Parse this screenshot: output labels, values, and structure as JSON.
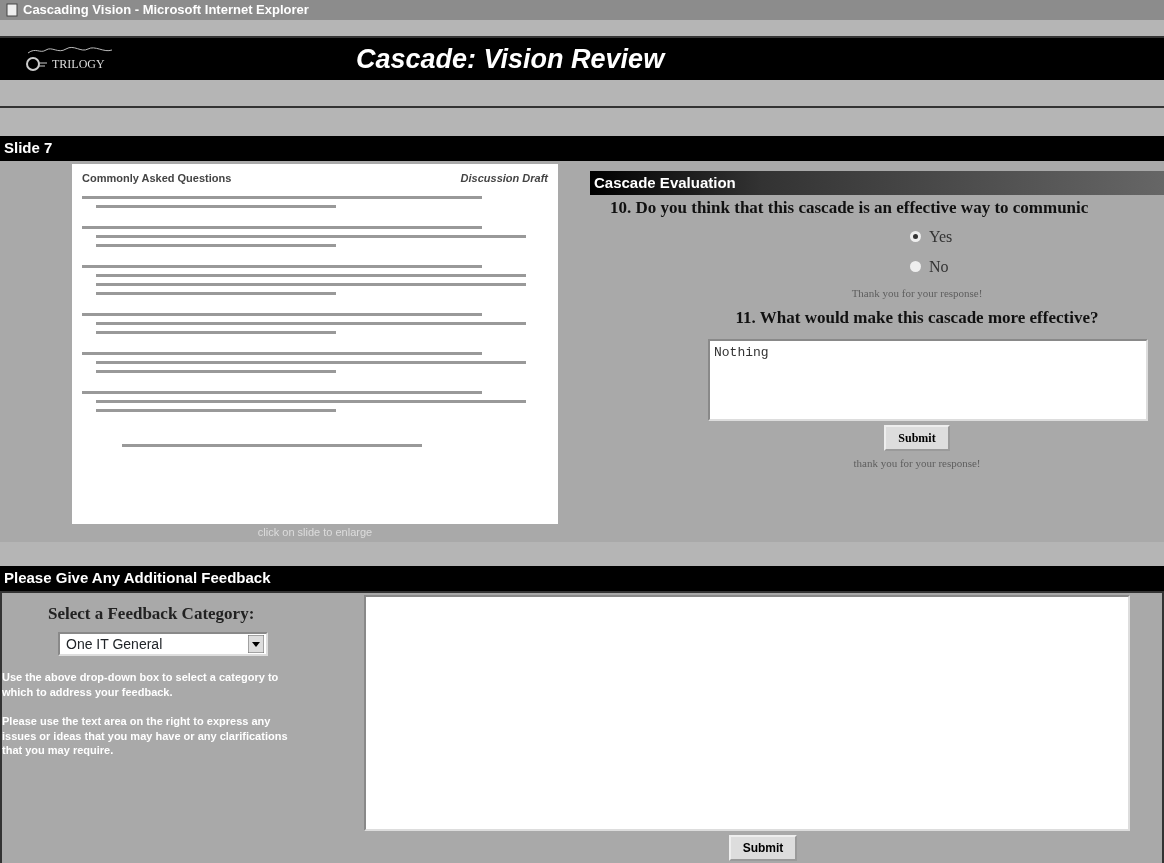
{
  "window": {
    "title": "Cascading Vision - Microsoft Internet Explorer"
  },
  "header": {
    "logo_text": "TRILOGY",
    "title": "Cascade: Vision Review"
  },
  "slide": {
    "heading": "Slide 7",
    "title": "Commonly Asked Questions",
    "tag": "Discussion Draft",
    "caption": "click on slide to enlarge"
  },
  "evaluation": {
    "heading": "Cascade Evaluation",
    "q10": {
      "text": "10. Do you think that this cascade is an effective way to communic",
      "note": "Thank you for your response!",
      "options": [
        {
          "label": "Yes",
          "selected": true
        },
        {
          "label": "No",
          "selected": false
        }
      ]
    },
    "q11": {
      "text": "11. What would make this cascade more effective?",
      "value": "Nothing",
      "button": "Submit",
      "note": "thank you for your response!"
    }
  },
  "feedback": {
    "heading": "Please Give Any Additional Feedback",
    "category_label": "Select a Feedback Category:",
    "category": "One IT General",
    "help": [
      "Use the above drop-down box to select a category to which to address your feedback.",
      "Please use the text area on the right to express any issues or ideas that you may have or any clarifications that you may require."
    ],
    "button": "Submit"
  }
}
